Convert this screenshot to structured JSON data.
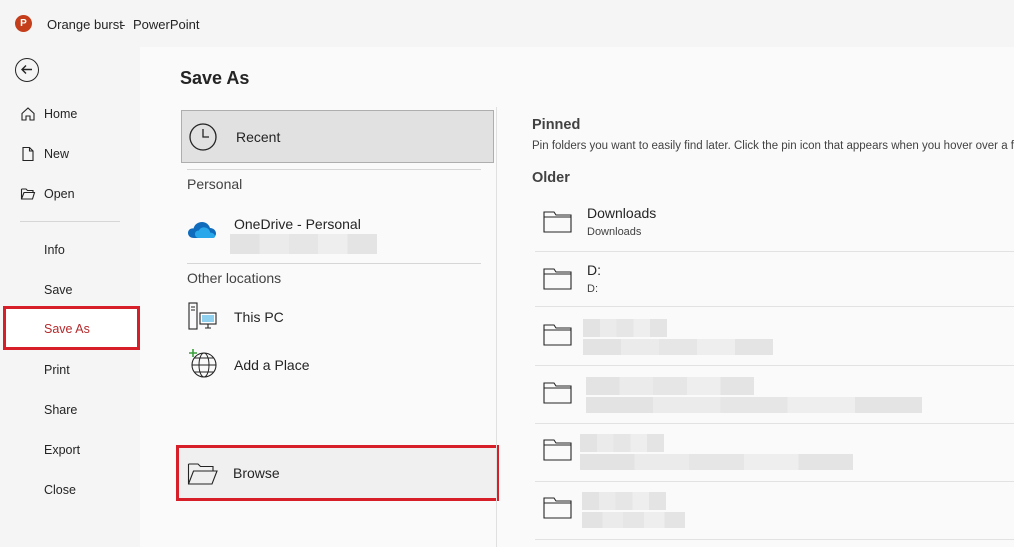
{
  "titlebar": {
    "app_icon_letter": "P",
    "document_name": "Orange burst",
    "separator": "-",
    "app_name": "PowerPoint"
  },
  "nav": {
    "items": [
      {
        "label": "Home",
        "icon": "home-icon"
      },
      {
        "label": "New",
        "icon": "new-doc-icon"
      },
      {
        "label": "Open",
        "icon": "open-folder-icon"
      },
      {
        "label": "Info"
      },
      {
        "label": "Save"
      },
      {
        "label": "Save As",
        "selected": true
      },
      {
        "label": "Print"
      },
      {
        "label": "Share"
      },
      {
        "label": "Export"
      },
      {
        "label": "Close"
      }
    ]
  },
  "page": {
    "title": "Save As"
  },
  "locations": {
    "recent": "Recent",
    "personal_header": "Personal",
    "onedrive": "OneDrive - Personal",
    "other_header": "Other locations",
    "this_pc": "This PC",
    "add_place": "Add a Place",
    "browse": "Browse"
  },
  "folders": {
    "pinned_heading": "Pinned",
    "pinned_desc": "Pin folders you want to easily find later. Click the pin icon that appears when you hover over a folder.",
    "older_heading": "Older",
    "items": [
      {
        "name": "Downloads",
        "path": "Downloads"
      },
      {
        "name": "D:",
        "path": "D:"
      }
    ]
  },
  "colors": {
    "accent_red": "#d71f2a",
    "powerpoint_orange": "#c43e1c"
  }
}
